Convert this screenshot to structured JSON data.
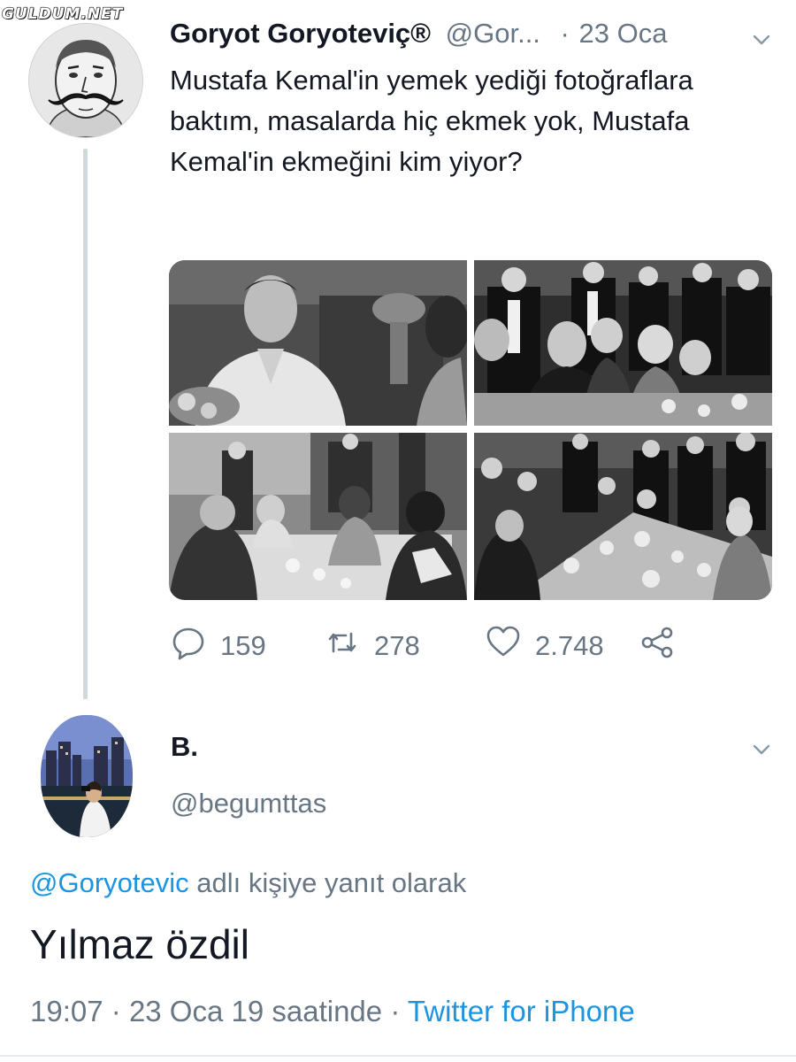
{
  "watermark": "GULDUM.NET",
  "tweet": {
    "author_name": "Goryot Goryoteviç®",
    "handle": "@Gor...",
    "separator": "·",
    "date": "23 Oca",
    "text": "Mustafa Kemal'in yemek yediği fotoğraflara baktım, masalarda hiç ekmek yok, Mustafa Kemal'in ekmeğini kim yiyor?",
    "actions": {
      "replies": "159",
      "retweets": "278",
      "likes": "2.748"
    }
  },
  "reply": {
    "author_name": "B.",
    "handle": "@begumttas",
    "reply_to_handle": "@Goryotevic",
    "reply_to_suffix": " adlı kişiye yanıt olarak",
    "text": "Yılmaz özdil",
    "time": "19:07",
    "date": "23 Oca 19 saatinde",
    "separator": "·",
    "client": "Twitter for iPhone"
  },
  "icons": {
    "reply": "reply-icon",
    "retweet": "retweet-icon",
    "like": "heart-icon",
    "share": "share-icon",
    "caret": "chevron-down-icon"
  },
  "colors": {
    "link": "#1b95e0",
    "muted": "#687684",
    "text": "#141823",
    "thread_line": "#cfd9de"
  }
}
